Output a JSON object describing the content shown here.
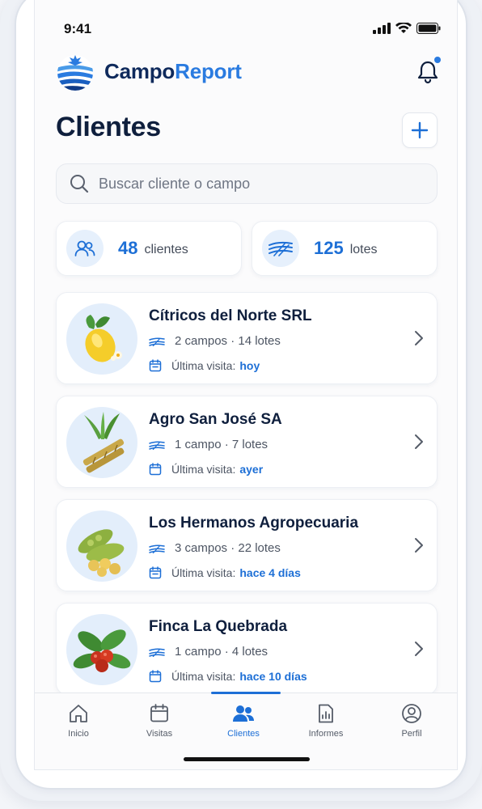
{
  "status_bar": {
    "time": "9:41"
  },
  "header": {
    "brand_part1": "Campo",
    "brand_part2": "Report"
  },
  "page": {
    "title": "Clientes"
  },
  "search": {
    "placeholder": "Buscar cliente o campo"
  },
  "stats": [
    {
      "value": "48",
      "label": "clientes",
      "icon": "people-icon"
    },
    {
      "value": "125",
      "label": "lotes",
      "icon": "field-rows-icon"
    }
  ],
  "clients": [
    {
      "name": "Cítricos del Norte SRL",
      "fields": "2 campos · 14 lotes",
      "visit_label": "Última visita:",
      "visit_value": "hoy",
      "icon": "lemon-icon"
    },
    {
      "name": "Agro San José SA",
      "fields": "1 campo · 7 lotes",
      "visit_label": "Última visita:",
      "visit_value": "ayer",
      "icon": "sugarcane-icon"
    },
    {
      "name": "Los Hermanos Agropecuaria",
      "fields": "3 campos · 22 lotes",
      "visit_label": "Última visita:",
      "visit_value": "hace 4 días",
      "icon": "soybean-icon"
    },
    {
      "name": "Finca La Quebrada",
      "fields": "1 campo · 4 lotes",
      "visit_label": "Última visita:",
      "visit_value": "hace 10 días",
      "icon": "coffee-icon"
    }
  ],
  "tabs": [
    {
      "label": "Inicio",
      "icon": "home-icon"
    },
    {
      "label": "Visitas",
      "icon": "calendar-icon"
    },
    {
      "label": "Clientes",
      "icon": "people-icon",
      "active": true
    },
    {
      "label": "Informes",
      "icon": "report-icon"
    },
    {
      "label": "Perfil",
      "icon": "profile-icon"
    }
  ],
  "colors": {
    "accent": "#1d6fd6",
    "brand_dark": "#0f2a5c",
    "brand_light": "#2a7be0"
  }
}
